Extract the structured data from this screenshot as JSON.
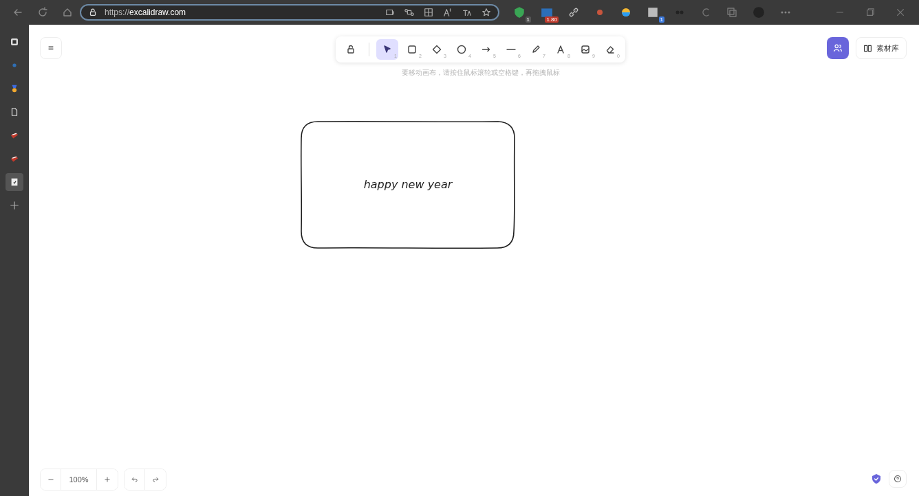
{
  "browser": {
    "url_scheme": "https://",
    "url_host": "excalidraw.com",
    "badges": [
      {
        "kind": "shield",
        "badge": "1"
      },
      {
        "kind": "video",
        "badge": "1.80"
      },
      {
        "kind": "note",
        "badge": "1"
      }
    ]
  },
  "sidebar": {
    "tabs": [
      {
        "kind": "panel",
        "selected": false
      },
      {
        "kind": "dot",
        "selected": false
      },
      {
        "kind": "medal",
        "selected": false
      },
      {
        "kind": "page",
        "selected": false
      },
      {
        "kind": "flag",
        "selected": false
      },
      {
        "kind": "flag",
        "selected": false
      },
      {
        "kind": "doc",
        "selected": true
      },
      {
        "kind": "plus",
        "selected": false
      }
    ]
  },
  "toolbar": {
    "tools": [
      {
        "kind": "lock",
        "selected": false
      },
      {
        "kind": "select",
        "shortcut": "1",
        "selected": true
      },
      {
        "kind": "rectangle",
        "shortcut": "2",
        "selected": false
      },
      {
        "kind": "diamond",
        "shortcut": "3",
        "selected": false
      },
      {
        "kind": "ellipse",
        "shortcut": "4",
        "selected": false
      },
      {
        "kind": "arrow",
        "shortcut": "5",
        "selected": false
      },
      {
        "kind": "line",
        "shortcut": "6",
        "selected": false
      },
      {
        "kind": "pencil",
        "shortcut": "7",
        "selected": false
      },
      {
        "kind": "text",
        "shortcut": "8",
        "selected": false
      },
      {
        "kind": "image",
        "shortcut": "9",
        "selected": false
      },
      {
        "kind": "eraser",
        "shortcut": "0",
        "selected": false
      }
    ]
  },
  "hint": "要移动画布，请按住鼠标滚轮或空格键，再拖拽鼠标",
  "library_button": "素材库",
  "canvas": {
    "shapes": [
      {
        "kind": "rectangle",
        "text": "happy new year"
      }
    ]
  },
  "zoom": {
    "value": "100%"
  }
}
